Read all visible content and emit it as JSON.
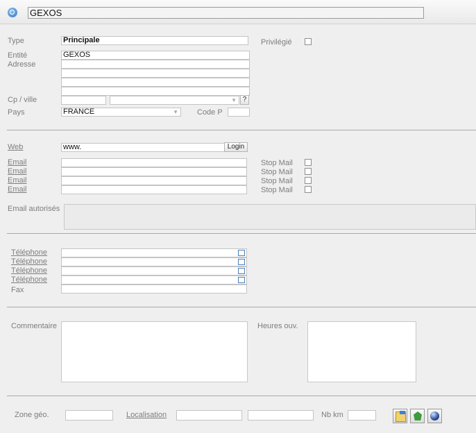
{
  "header": {
    "search_value": "GEXOS"
  },
  "address": {
    "type_label": "Type",
    "type_value": "Principale",
    "privilege_label": "Privilégié",
    "entity_label": "Entité",
    "entity_value": "GEXOS",
    "address_label": "Adresse",
    "cp_label": "Cp / ville",
    "city_help": "?",
    "country_label": "Pays",
    "country_value": "FRANCE",
    "code_p_label": "Code P"
  },
  "web": {
    "web_label": "Web",
    "web_value": "www.",
    "login_label": "Login",
    "emails": [
      {
        "label": "Email",
        "stop_label": "Stop Mail"
      },
      {
        "label": "Email",
        "stop_label": "Stop Mail"
      },
      {
        "label": "Email",
        "stop_label": "Stop Mail"
      },
      {
        "label": "Email",
        "stop_label": "Stop Mail"
      }
    ],
    "authorized_label": "Email autorisés"
  },
  "phones": {
    "items": [
      {
        "label": "Téléphone"
      },
      {
        "label": "Téléphone"
      },
      {
        "label": "Téléphone"
      },
      {
        "label": "Téléphone"
      }
    ],
    "fax_label": "Fax"
  },
  "comments": {
    "comment_label": "Commentaire",
    "hours_label": "Heures ouv."
  },
  "geo": {
    "zone_label": "Zone géo.",
    "localisation_label": "Localisation",
    "nbkm_label": "Nb km"
  },
  "icons": {
    "search": "search-icon",
    "map": "map-icon",
    "france": "france-map-icon",
    "globe": "globe-icon"
  }
}
